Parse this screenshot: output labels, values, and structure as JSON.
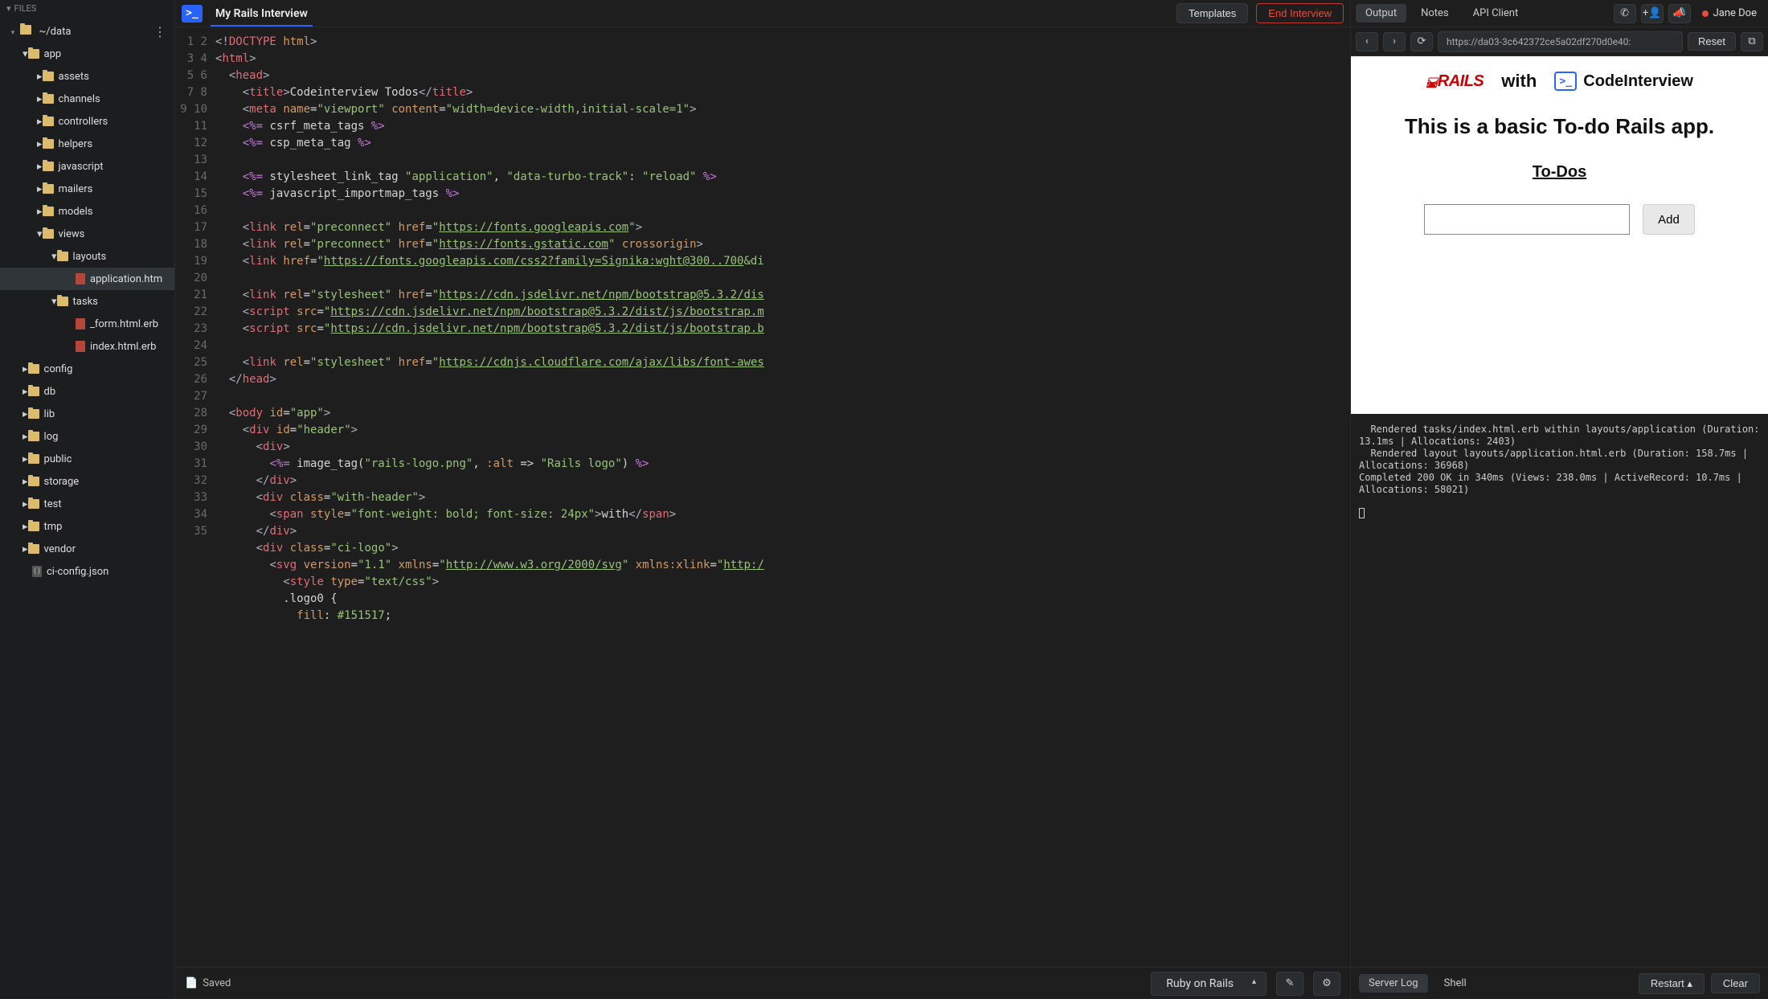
{
  "sidebar": {
    "header": "FILES",
    "root": "~/data",
    "tree": [
      {
        "label": "app",
        "type": "folder",
        "depth": 1,
        "expanded": true
      },
      {
        "label": "assets",
        "type": "folder",
        "depth": 2,
        "expanded": false
      },
      {
        "label": "channels",
        "type": "folder",
        "depth": 2,
        "expanded": false
      },
      {
        "label": "controllers",
        "type": "folder",
        "depth": 2,
        "expanded": false
      },
      {
        "label": "helpers",
        "type": "folder",
        "depth": 2,
        "expanded": false
      },
      {
        "label": "javascript",
        "type": "folder",
        "depth": 2,
        "expanded": false
      },
      {
        "label": "mailers",
        "type": "folder",
        "depth": 2,
        "expanded": false
      },
      {
        "label": "models",
        "type": "folder",
        "depth": 2,
        "expanded": false
      },
      {
        "label": "views",
        "type": "folder",
        "depth": 2,
        "expanded": true
      },
      {
        "label": "layouts",
        "type": "folder",
        "depth": 3,
        "expanded": true
      },
      {
        "label": "application.htm",
        "type": "file-erb",
        "depth": 4,
        "selected": true
      },
      {
        "label": "tasks",
        "type": "folder",
        "depth": 3,
        "expanded": true
      },
      {
        "label": "_form.html.erb",
        "type": "file-erb",
        "depth": 4
      },
      {
        "label": "index.html.erb",
        "type": "file-erb",
        "depth": 4
      },
      {
        "label": "config",
        "type": "folder",
        "depth": 1,
        "expanded": false
      },
      {
        "label": "db",
        "type": "folder",
        "depth": 1,
        "expanded": false
      },
      {
        "label": "lib",
        "type": "folder",
        "depth": 1,
        "expanded": false
      },
      {
        "label": "log",
        "type": "folder",
        "depth": 1,
        "expanded": false
      },
      {
        "label": "public",
        "type": "folder",
        "depth": 1,
        "expanded": false
      },
      {
        "label": "storage",
        "type": "folder",
        "depth": 1,
        "expanded": false
      },
      {
        "label": "test",
        "type": "folder",
        "depth": 1,
        "expanded": false
      },
      {
        "label": "tmp",
        "type": "folder",
        "depth": 1,
        "expanded": false
      },
      {
        "label": "vendor",
        "type": "folder",
        "depth": 1,
        "expanded": false
      },
      {
        "label": "ci-config.json",
        "type": "file-json",
        "depth": 1
      }
    ]
  },
  "topbar": {
    "session_title": "My Rails Interview",
    "templates_label": "Templates",
    "end_interview_label": "End Interview"
  },
  "editor": {
    "line_start": 1,
    "line_end": 35,
    "lines_html": [
      "<span class='tok-punc'>&lt;!</span><span class='tok-tag'>DOCTYPE</span> <span class='tok-attr'>html</span><span class='tok-punc'>&gt;</span>",
      "<span class='tok-punc'>&lt;</span><span class='tok-tag'>html</span><span class='tok-punc'>&gt;</span>",
      "  <span class='tok-punc'>&lt;</span><span class='tok-tag'>head</span><span class='tok-punc'>&gt;</span>",
      "    <span class='tok-punc'>&lt;</span><span class='tok-tag'>title</span><span class='tok-punc'>&gt;</span>Codeinterview Todos<span class='tok-punc'>&lt;/</span><span class='tok-tag'>title</span><span class='tok-punc'>&gt;</span>",
      "    <span class='tok-punc'>&lt;</span><span class='tok-tag'>meta</span> <span class='tok-attr'>name</span>=<span class='tok-str'>\"viewport\"</span> <span class='tok-attr'>content</span>=<span class='tok-str'>\"width=device-width,initial-scale=1\"</span><span class='tok-punc'>&gt;</span>",
      "    <span class='tok-erb'>&lt;%=</span> csrf_meta_tags <span class='tok-erb'>%&gt;</span>",
      "    <span class='tok-erb'>&lt;%=</span> csp_meta_tag <span class='tok-erb'>%&gt;</span>",
      "",
      "    <span class='tok-erb'>&lt;%=</span> stylesheet_link_tag <span class='tok-str'>\"application\"</span>, <span class='tok-str'>\"data-turbo-track\"</span>: <span class='tok-str'>\"reload\"</span> <span class='tok-erb'>%&gt;</span>",
      "    <span class='tok-erb'>&lt;%=</span> javascript_importmap_tags <span class='tok-erb'>%&gt;</span>",
      "",
      "    <span class='tok-punc'>&lt;</span><span class='tok-tag'>link</span> <span class='tok-attr'>rel</span>=<span class='tok-str'>\"preconnect\"</span> <span class='tok-attr'>href</span>=<span class='tok-str'>\"</span><span class='tok-url'>https://fonts.googleapis.com</span><span class='tok-str'>\"</span><span class='tok-punc'>&gt;</span>",
      "    <span class='tok-punc'>&lt;</span><span class='tok-tag'>link</span> <span class='tok-attr'>rel</span>=<span class='tok-str'>\"preconnect\"</span> <span class='tok-attr'>href</span>=<span class='tok-str'>\"</span><span class='tok-url'>https://fonts.gstatic.com</span><span class='tok-str'>\"</span> <span class='tok-attr'>crossorigin</span><span class='tok-punc'>&gt;</span>",
      "    <span class='tok-punc'>&lt;</span><span class='tok-tag'>link</span> <span class='tok-attr'>href</span>=<span class='tok-str'>\"</span><span class='tok-url'>https://fonts.googleapis.com/css2?family=Signika:wght@300..700</span><span class='tok-str'>&amp;di</span>",
      "",
      "    <span class='tok-punc'>&lt;</span><span class='tok-tag'>link</span> <span class='tok-attr'>rel</span>=<span class='tok-str'>\"stylesheet\"</span> <span class='tok-attr'>href</span>=<span class='tok-str'>\"</span><span class='tok-url'>https://cdn.jsdelivr.net/npm/bootstrap@5.3.2/dis</span>",
      "    <span class='tok-punc'>&lt;</span><span class='tok-tag'>script</span> <span class='tok-attr'>src</span>=<span class='tok-str'>\"</span><span class='tok-url'>https://cdn.jsdelivr.net/npm/bootstrap@5.3.2/dist/js/bootstrap.m</span>",
      "    <span class='tok-punc'>&lt;</span><span class='tok-tag'>script</span> <span class='tok-attr'>src</span>=<span class='tok-str'>\"</span><span class='tok-url'>https://cdn.jsdelivr.net/npm/bootstrap@5.3.2/dist/js/bootstrap.b</span>",
      "",
      "    <span class='tok-punc'>&lt;</span><span class='tok-tag'>link</span> <span class='tok-attr'>rel</span>=<span class='tok-str'>\"stylesheet\"</span> <span class='tok-attr'>href</span>=<span class='tok-str'>\"</span><span class='tok-url'>https://cdnjs.cloudflare.com/ajax/libs/font-awes</span>",
      "  <span class='tok-punc'>&lt;/</span><span class='tok-tag'>head</span><span class='tok-punc'>&gt;</span>",
      "",
      "  <span class='tok-punc'>&lt;</span><span class='tok-tag'>body</span> <span class='tok-attr'>id</span>=<span class='tok-str'>\"app\"</span><span class='tok-punc'>&gt;</span>",
      "    <span class='tok-punc'>&lt;</span><span class='tok-tag'>div</span> <span class='tok-attr'>id</span>=<span class='tok-str'>\"header\"</span><span class='tok-punc'>&gt;</span>",
      "      <span class='tok-punc'>&lt;</span><span class='tok-tag'>div</span><span class='tok-punc'>&gt;</span>",
      "        <span class='tok-erb'>&lt;%=</span> image_tag(<span class='tok-str'>\"rails-logo.png\"</span>, <span class='tok-attr'>:alt</span> =&gt; <span class='tok-str'>\"Rails logo\"</span>) <span class='tok-erb'>%&gt;</span>",
      "      <span class='tok-punc'>&lt;/</span><span class='tok-tag'>div</span><span class='tok-punc'>&gt;</span>",
      "      <span class='tok-punc'>&lt;</span><span class='tok-tag'>div</span> <span class='tok-attr'>class</span>=<span class='tok-str'>\"with-header\"</span><span class='tok-punc'>&gt;</span>",
      "        <span class='tok-punc'>&lt;</span><span class='tok-tag'>span</span> <span class='tok-attr'>style</span>=<span class='tok-str'>\"font-weight: bold; font-size: 24px\"</span><span class='tok-punc'>&gt;</span>with<span class='tok-punc'>&lt;/</span><span class='tok-tag'>span</span><span class='tok-punc'>&gt;</span>",
      "      <span class='tok-punc'>&lt;/</span><span class='tok-tag'>div</span><span class='tok-punc'>&gt;</span>",
      "      <span class='tok-punc'>&lt;</span><span class='tok-tag'>div</span> <span class='tok-attr'>class</span>=<span class='tok-str'>\"ci-logo\"</span><span class='tok-punc'>&gt;</span>",
      "        <span class='tok-punc'>&lt;</span><span class='tok-tag'>svg</span> <span class='tok-attr'>version</span>=<span class='tok-str'>\"1.1\"</span> <span class='tok-attr'>xmlns</span>=<span class='tok-str'>\"</span><span class='tok-url'>http://www.w3.org/2000/svg</span><span class='tok-str'>\"</span> <span class='tok-attr'>xmlns:xlink</span>=<span class='tok-str'>\"</span><span class='tok-url'>http:/</span>",
      "          <span class='tok-punc'>&lt;</span><span class='tok-tag'>style</span> <span class='tok-attr'>type</span>=<span class='tok-str'>\"text/css\"</span><span class='tok-punc'>&gt;</span>",
      "          .logo0 {",
      "            <span class='tok-attr'>fill</span>: <span class='tok-str'>#151517</span>;"
    ]
  },
  "statusbar": {
    "saved_label": "Saved",
    "language": "Ruby on Rails"
  },
  "right": {
    "tabs": [
      "Output",
      "Notes",
      "API Client"
    ],
    "active_tab": 0,
    "user_name": "Jane Doe",
    "browser": {
      "url": "https://da03-3c642372ce5a02df270d0e40:",
      "reset_label": "Reset"
    },
    "preview": {
      "rails_label": "RAILS",
      "with_label": "with",
      "ci_label": "CodeInterview",
      "heading": "This is a basic To-do Rails app.",
      "subheading": "To-Dos",
      "add_label": "Add"
    },
    "console_text": "  Rendered tasks/index.html.erb within layouts/application (Duration: 13.1ms | Allocations: 2403)\n  Rendered layout layouts/application.html.erb (Duration: 158.7ms | Allocations: 36968)\nCompleted 200 OK in 340ms (Views: 238.0ms | ActiveRecord: 10.7ms | Allocations: 58021)\n",
    "bottom": {
      "server_log_label": "Server Log",
      "shell_label": "Shell",
      "restart_label": "Restart",
      "clear_label": "Clear"
    }
  }
}
